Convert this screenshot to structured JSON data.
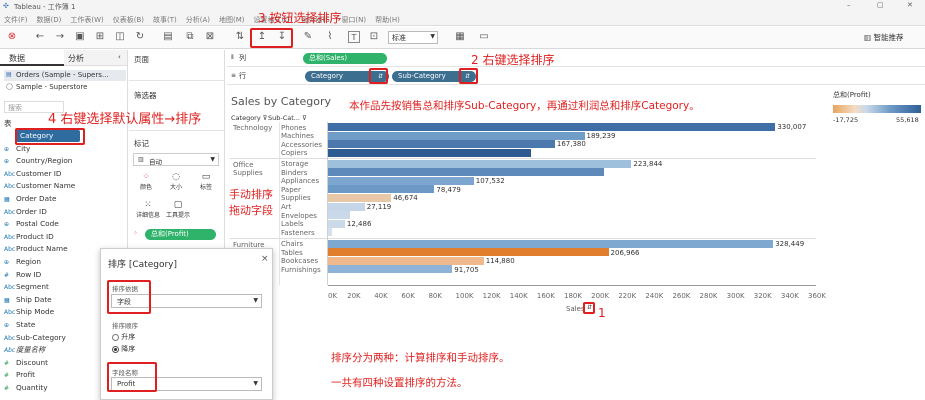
{
  "window": {
    "title": "Tableau - 工作簿 1"
  },
  "menu": [
    "文件(F)",
    "数据(D)",
    "工作表(W)",
    "仪表板(B)",
    "故事(T)",
    "分析(A)",
    "地图(M)",
    "设置格式(O)",
    "服务器(S)",
    "窗口(N)",
    "帮助(H)"
  ],
  "toolbar": {
    "fit_value": "标准",
    "smart": "智能推荐"
  },
  "left": {
    "tab_data": "数据",
    "tab_analysis": "分析",
    "source1": "Orders (Sample - Supers...",
    "source2": "Sample - Superstore",
    "search_placeholder": "搜索",
    "table_label": "表"
  },
  "fields": [
    {
      "t": "Abc",
      "name": "Category",
      "m": false
    },
    {
      "t": "⊕",
      "name": "City",
      "m": false
    },
    {
      "t": "⊕",
      "name": "Country/Region",
      "m": false
    },
    {
      "t": "Abc",
      "name": "Customer ID",
      "m": false
    },
    {
      "t": "Abc",
      "name": "Customer Name",
      "m": false
    },
    {
      "t": "▦",
      "name": "Order Date",
      "m": false
    },
    {
      "t": "Abc",
      "name": "Order ID",
      "m": false
    },
    {
      "t": "⊕",
      "name": "Postal Code",
      "m": false
    },
    {
      "t": "Abc",
      "name": "Product ID",
      "m": false
    },
    {
      "t": "Abc",
      "name": "Product Name",
      "m": false
    },
    {
      "t": "⊕",
      "name": "Region",
      "m": false
    },
    {
      "t": "#",
      "name": "Row ID",
      "m": false
    },
    {
      "t": "Abc",
      "name": "Segment",
      "m": false
    },
    {
      "t": "▦",
      "name": "Ship Date",
      "m": false
    },
    {
      "t": "Abc",
      "name": "Ship Mode",
      "m": false
    },
    {
      "t": "⊕",
      "name": "State",
      "m": false
    },
    {
      "t": "Abc",
      "name": "Sub-Category",
      "m": false
    },
    {
      "t": "Abc",
      "name": "度量名称",
      "m": false
    },
    {
      "t": "#",
      "name": "Discount",
      "m": true
    },
    {
      "t": "#",
      "name": "Profit",
      "m": true
    },
    {
      "t": "#",
      "name": "Quantity",
      "m": true
    }
  ],
  "mid": {
    "pages": "页面",
    "filters": "筛选器",
    "marks": "标记",
    "mark_type": "自动",
    "color": "颜色",
    "size": "大小",
    "label": "标签",
    "detail": "详细信息",
    "tooltip": "工具提示",
    "profit_pill": "总和(Profit)"
  },
  "shelves": {
    "cols_label": "列",
    "rows_label": "行",
    "col_pill": "总和(Sales)",
    "row_pill1": "Category",
    "row_pill2": "Sub-Category"
  },
  "legend": {
    "title": "总和(Profit)",
    "min": "-17,725",
    "max": "55,618"
  },
  "annotations": {
    "a1": "3 按钮选择排序",
    "a2": "2 右键选择排序",
    "a3": "本作品先按销售总和排序Sub-Category，再通过利润总和排序Category。",
    "a4": "4 右键选择默认属性→排序",
    "a5": "手动排序\n拖动字段",
    "a6": "1",
    "a7": "排序分为两种：计算排序和手动排序。",
    "a8": "一共有四种设置排序的方法。"
  },
  "dialog": {
    "title": "排序 [Category]",
    "sort_by_label": "排序依据",
    "sort_by_value": "字段",
    "order_label": "排序顺序",
    "asc": "升序",
    "desc": "降序",
    "field_name_label": "字段名称",
    "field_name_value": "Profit"
  },
  "chart_data": {
    "type": "bar",
    "title": "Sales by Category",
    "header_cat": "Category",
    "header_sub": "Sub-Cat...",
    "xlabel": "Sales",
    "xlim": [
      0,
      360000
    ],
    "xticks": [
      "0K",
      "20K",
      "40K",
      "60K",
      "80K",
      "100K",
      "120K",
      "140K",
      "160K",
      "180K",
      "200K",
      "220K",
      "240K",
      "260K",
      "280K",
      "300K",
      "320K",
      "340K",
      "360K"
    ],
    "colors": [
      "#4a74a8",
      "#dc8a3f"
    ],
    "groups": [
      {
        "category": "Technology",
        "rows": [
          {
            "sub": "Phones",
            "value": 330007,
            "label": "330,007",
            "color": "#3f6da6"
          },
          {
            "sub": "Machines",
            "value": 189239,
            "label": "189,239",
            "color": "#6f9dc8"
          },
          {
            "sub": "Accessories",
            "value": 167380,
            "label": "167,380",
            "color": "#4b78ad"
          },
          {
            "sub": "Copiers",
            "value": 149528,
            "label": "",
            "color": "#2c5a91"
          }
        ]
      },
      {
        "category": "Office Supplies",
        "rows": [
          {
            "sub": "Storage",
            "value": 223844,
            "label": "223,844",
            "color": "#9fc0dc"
          },
          {
            "sub": "Binders",
            "value": 203413,
            "label": "",
            "color": "#5d89bb"
          },
          {
            "sub": "Appliances",
            "value": 107532,
            "label": "107,532",
            "color": "#7ca6cf"
          },
          {
            "sub": "Paper",
            "value": 78479,
            "label": "78,479",
            "color": "#6d99c6"
          },
          {
            "sub": "Supplies",
            "value": 46674,
            "label": "46,674",
            "color": "#e9c8a8"
          },
          {
            "sub": "Art",
            "value": 27119,
            "label": "27,119",
            "color": "#c5d6e8"
          },
          {
            "sub": "Envelopes",
            "value": 16476,
            "label": "",
            "color": "#c9d9ea"
          },
          {
            "sub": "Labels",
            "value": 12486,
            "label": "12,486",
            "color": "#cbdae9"
          },
          {
            "sub": "Fasteners",
            "value": 3024,
            "label": "",
            "color": "#d6e1ec"
          }
        ]
      },
      {
        "category": "Furniture",
        "rows": [
          {
            "sub": "Chairs",
            "value": 328449,
            "label": "328,449",
            "color": "#7fa8d0"
          },
          {
            "sub": "Tables",
            "value": 206966,
            "label": "206,966",
            "color": "#e07e2e"
          },
          {
            "sub": "Bookcases",
            "value": 114880,
            "label": "114,880",
            "color": "#efb98d"
          },
          {
            "sub": "Furnishings",
            "value": 91705,
            "label": "91,705",
            "color": "#8fb3d6"
          }
        ]
      }
    ]
  }
}
